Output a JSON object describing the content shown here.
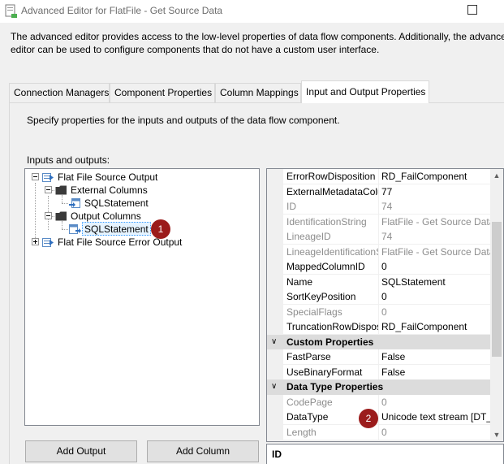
{
  "window": {
    "title": "Advanced Editor for FlatFile - Get Source Data"
  },
  "description": {
    "line1": "The advanced editor provides access to the low-level properties of data flow components. Additionally, the advanced",
    "line2": "editor can be used to configure components that do not have a custom user interface."
  },
  "tabs": [
    {
      "label": "Connection Managers",
      "active": false
    },
    {
      "label": "Component Properties",
      "active": false
    },
    {
      "label": "Column Mappings",
      "active": false
    },
    {
      "label": "Input and Output Properties",
      "active": true
    }
  ],
  "panel": {
    "description": "Specify properties for the inputs and outputs of the data flow component.",
    "io_label": "Inputs and outputs:"
  },
  "tree": {
    "output": "Flat File Source Output",
    "external_columns": "External Columns",
    "external_col_item": "SQLStatement",
    "output_columns": "Output Columns",
    "output_col_item": "SQLStatement",
    "error_output": "Flat File Source Error Output"
  },
  "badges": {
    "one": "1",
    "two": "2"
  },
  "buttons": {
    "add_output": "Add Output",
    "add_column": "Add Column"
  },
  "properties": {
    "rows_common": [
      {
        "name": "ErrorRowDisposition",
        "value": "RD_FailComponent",
        "readonly": false
      },
      {
        "name": "ExternalMetadataColumnID",
        "value": "77",
        "readonly": false
      },
      {
        "name": "ID",
        "value": "74",
        "readonly": true
      },
      {
        "name": "IdentificationString",
        "value": "FlatFile - Get Source Data",
        "readonly": true
      },
      {
        "name": "LineageID",
        "value": "74",
        "readonly": true
      },
      {
        "name": "LineageIdentificationString",
        "value": "FlatFile - Get Source Data",
        "readonly": true
      },
      {
        "name": "MappedColumnID",
        "value": "0",
        "readonly": false
      },
      {
        "name": "Name",
        "value": "SQLStatement",
        "readonly": false
      },
      {
        "name": "SortKeyPosition",
        "value": "0",
        "readonly": false
      },
      {
        "name": "SpecialFlags",
        "value": "0",
        "readonly": true
      },
      {
        "name": "TruncationRowDisposition",
        "value": "RD_FailComponent",
        "readonly": false
      }
    ],
    "custom_category": "Custom Properties",
    "rows_custom": [
      {
        "name": "FastParse",
        "value": "False",
        "readonly": false
      },
      {
        "name": "UseBinaryFormat",
        "value": "False",
        "readonly": false
      }
    ],
    "datatype_category": "Data Type Properties",
    "rows_datatype": [
      {
        "name": "CodePage",
        "value": "0",
        "readonly": true
      },
      {
        "name": "DataType",
        "value": "Unicode text stream [DT_NTEXT]",
        "readonly": false
      },
      {
        "name": "Length",
        "value": "0",
        "readonly": true
      }
    ]
  },
  "description_pane": {
    "title": "ID"
  }
}
